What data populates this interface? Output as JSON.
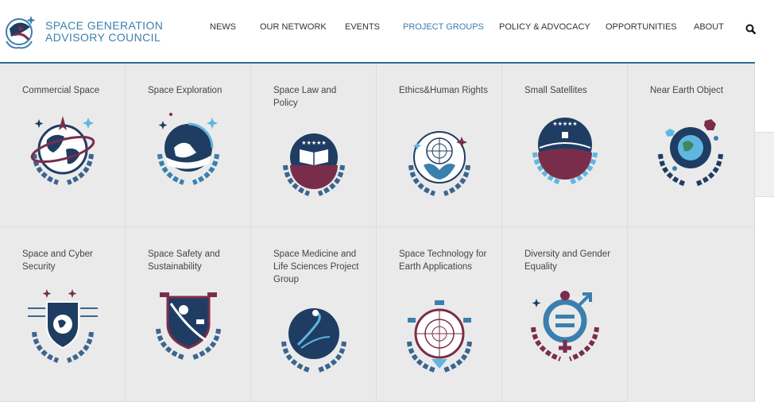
{
  "brand": {
    "line1": "SPACE GENERATION",
    "line2": "ADVISORY COUNCIL"
  },
  "nav": [
    {
      "label": "NEWS",
      "active": false
    },
    {
      "label": "OUR NETWORK",
      "active": false
    },
    {
      "label": "EVENTS",
      "active": false
    },
    {
      "label": "PROJECT GROUPS",
      "active": true
    },
    {
      "label": "POLICY & ADVOCACY",
      "active": false
    },
    {
      "label": "OPPORTUNITIES",
      "active": false
    },
    {
      "label": "ABOUT",
      "active": false
    }
  ],
  "colors": {
    "accent": "#3b7fae",
    "navy": "#1f3d63",
    "maroon": "#7a2d4b",
    "light_blue": "#5fb6e0",
    "panel": "#eaeaea"
  },
  "project_groups": [
    {
      "label": "Commercial Space",
      "icon": "commercial-space-emblem-icon"
    },
    {
      "label": "Space Exploration",
      "icon": "space-exploration-emblem-icon"
    },
    {
      "label": "Space Law and Policy",
      "icon": "space-law-emblem-icon"
    },
    {
      "label": "Ethics&Human Rights",
      "icon": "ethics-emblem-icon"
    },
    {
      "label": "Small Satellites",
      "icon": "small-satellites-emblem-icon"
    },
    {
      "label": "Near Earth Object",
      "icon": "near-earth-object-emblem-icon"
    },
    {
      "label": "Space and Cyber Security",
      "icon": "cyber-security-emblem-icon"
    },
    {
      "label": "Space Safety and Sustainability",
      "icon": "space-safety-emblem-icon"
    },
    {
      "label": "Space Medicine and Life Sciences Project Group",
      "icon": "space-medicine-emblem-icon"
    },
    {
      "label": "Space Technology for Earth Applications",
      "icon": "space-technology-emblem-icon"
    },
    {
      "label": "Diversity and Gender Equality",
      "icon": "diversity-emblem-icon"
    }
  ]
}
